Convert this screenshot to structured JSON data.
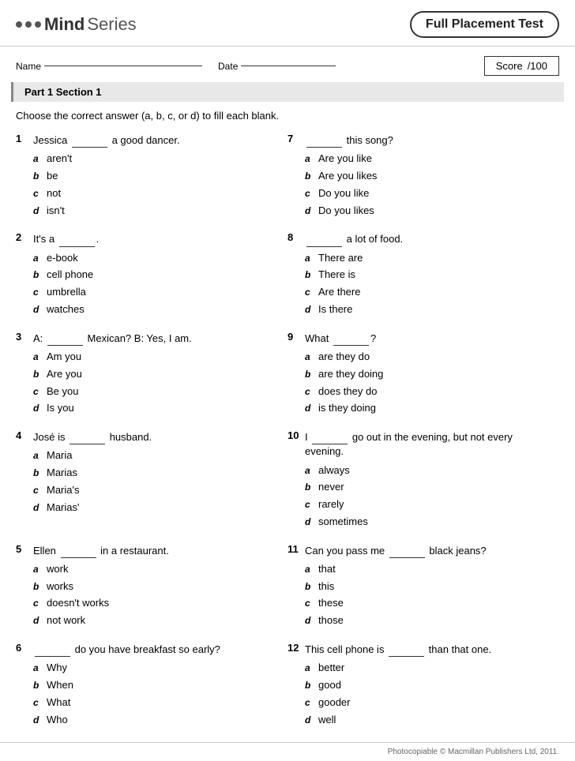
{
  "header": {
    "logo_mind": "Mind",
    "logo_series": "Series",
    "title": "Full Placement Test"
  },
  "info": {
    "name_label": "Name",
    "date_label": "Date",
    "score_label": "Score",
    "score_value": "/100"
  },
  "section": {
    "label": "Part 1  Section 1"
  },
  "instructions": "Choose the correct answer (a, b, c, or d) to fill each blank.",
  "questions": [
    {
      "num": "1",
      "text": "Jessica _____ a good dancer.",
      "options": [
        {
          "letter": "a",
          "text": "aren't"
        },
        {
          "letter": "b",
          "text": "be"
        },
        {
          "letter": "c",
          "text": "not"
        },
        {
          "letter": "d",
          "text": "isn't"
        }
      ]
    },
    {
      "num": "2",
      "text": "It's a _____.",
      "options": [
        {
          "letter": "a",
          "text": "e-book"
        },
        {
          "letter": "b",
          "text": "cell phone"
        },
        {
          "letter": "c",
          "text": "umbrella"
        },
        {
          "letter": "d",
          "text": "watches"
        }
      ]
    },
    {
      "num": "3",
      "text": "A: _____ Mexican? B: Yes, I am.",
      "options": [
        {
          "letter": "a",
          "text": "Am you"
        },
        {
          "letter": "b",
          "text": "Are you"
        },
        {
          "letter": "c",
          "text": "Be you"
        },
        {
          "letter": "d",
          "text": "Is you"
        }
      ]
    },
    {
      "num": "4",
      "text": "José is _____ husband.",
      "options": [
        {
          "letter": "a",
          "text": "Maria"
        },
        {
          "letter": "b",
          "text": "Marias"
        },
        {
          "letter": "c",
          "text": "Maria's"
        },
        {
          "letter": "d",
          "text": "Marias'"
        }
      ]
    },
    {
      "num": "5",
      "text": "Ellen _____ in a restaurant.",
      "options": [
        {
          "letter": "a",
          "text": "work"
        },
        {
          "letter": "b",
          "text": "works"
        },
        {
          "letter": "c",
          "text": "doesn't works"
        },
        {
          "letter": "d",
          "text": "not work"
        }
      ]
    },
    {
      "num": "6",
      "text": "_____ do you have breakfast so early?",
      "options": [
        {
          "letter": "a",
          "text": "Why"
        },
        {
          "letter": "b",
          "text": "When"
        },
        {
          "letter": "c",
          "text": "What"
        },
        {
          "letter": "d",
          "text": "Who"
        }
      ]
    },
    {
      "num": "7",
      "text": "_____ this song?",
      "options": [
        {
          "letter": "a",
          "text": "Are you like"
        },
        {
          "letter": "b",
          "text": "Are you likes"
        },
        {
          "letter": "c",
          "text": "Do you like"
        },
        {
          "letter": "d",
          "text": "Do you likes"
        }
      ]
    },
    {
      "num": "8",
      "text": "_____ a lot of food.",
      "options": [
        {
          "letter": "a",
          "text": "There are"
        },
        {
          "letter": "b",
          "text": "There is"
        },
        {
          "letter": "c",
          "text": "Are there"
        },
        {
          "letter": "d",
          "text": "Is there"
        }
      ]
    },
    {
      "num": "9",
      "text": "What _____?",
      "options": [
        {
          "letter": "a",
          "text": "are they do"
        },
        {
          "letter": "b",
          "text": "are they doing"
        },
        {
          "letter": "c",
          "text": "does they do"
        },
        {
          "letter": "d",
          "text": "is they doing"
        }
      ]
    },
    {
      "num": "10",
      "text": "I _____ go out in the evening, but not every evening.",
      "options": [
        {
          "letter": "a",
          "text": "always"
        },
        {
          "letter": "b",
          "text": "never"
        },
        {
          "letter": "c",
          "text": "rarely"
        },
        {
          "letter": "d",
          "text": "sometimes"
        }
      ]
    },
    {
      "num": "11",
      "text": "Can you pass me _____ black jeans?",
      "options": [
        {
          "letter": "a",
          "text": "that"
        },
        {
          "letter": "b",
          "text": "this"
        },
        {
          "letter": "c",
          "text": "these"
        },
        {
          "letter": "d",
          "text": "those"
        }
      ]
    },
    {
      "num": "12",
      "text": "This cell phone is _____ than that one.",
      "options": [
        {
          "letter": "a",
          "text": "better"
        },
        {
          "letter": "b",
          "text": "good"
        },
        {
          "letter": "c",
          "text": "gooder"
        },
        {
          "letter": "d",
          "text": "well"
        }
      ]
    }
  ],
  "footer": {
    "copyright": "Photocopiable © Macmillan Publishers Ltd, 2011."
  }
}
